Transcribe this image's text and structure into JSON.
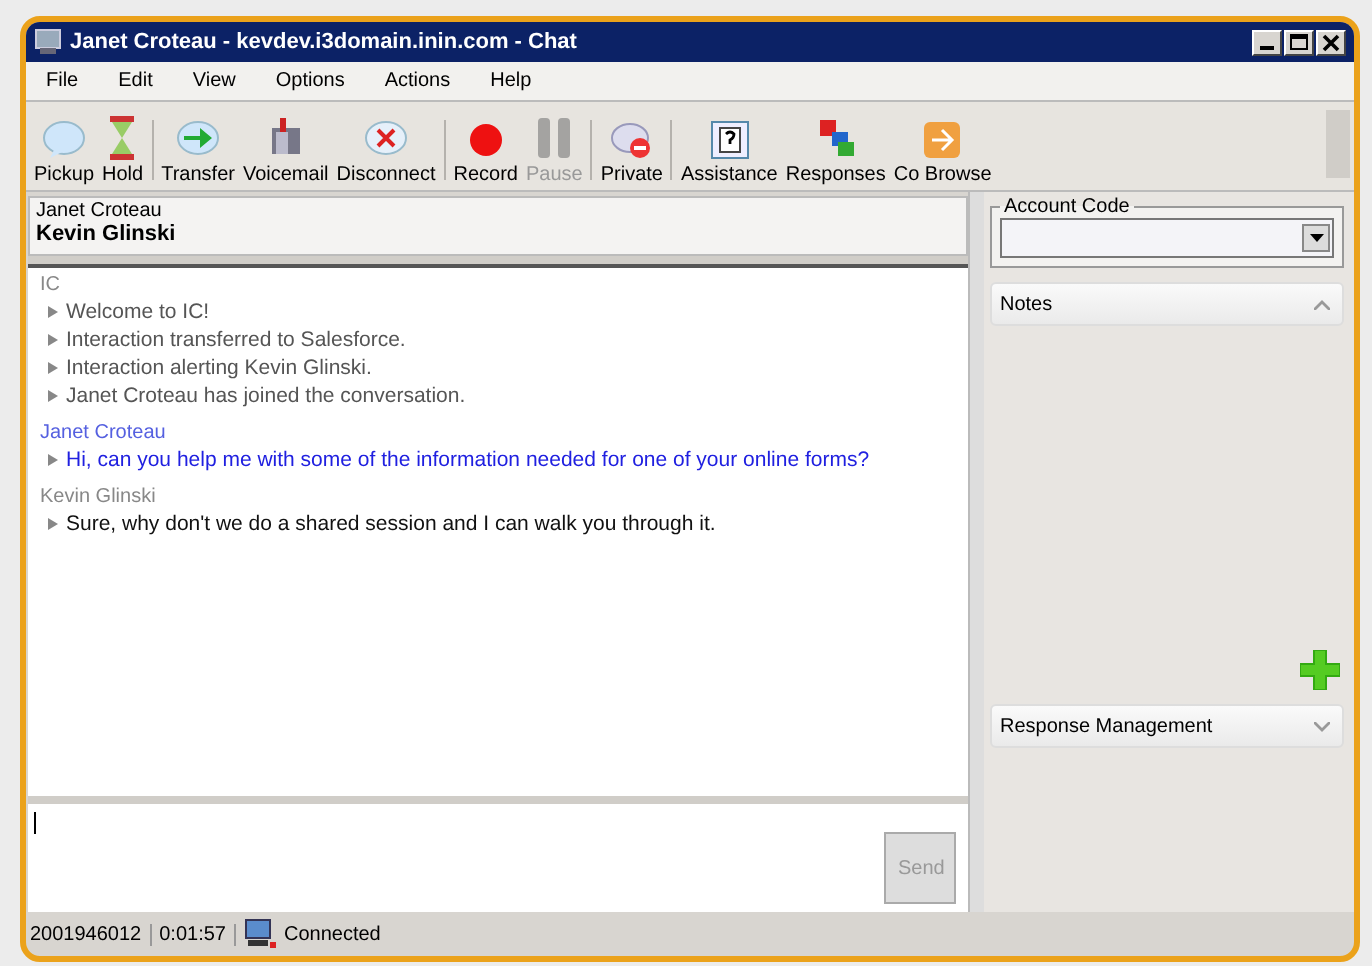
{
  "window": {
    "title": "Janet Croteau - kevdev.i3domain.inin.com - Chat"
  },
  "menu": [
    "File",
    "Edit",
    "View",
    "Options",
    "Actions",
    "Help"
  ],
  "toolbar": [
    {
      "label": "Pickup",
      "kind": "pickup",
      "disabled": false,
      "separator_before": false
    },
    {
      "label": "Hold",
      "kind": "hold",
      "disabled": false,
      "separator_before": false
    },
    {
      "label": "Transfer",
      "kind": "transfer",
      "disabled": false,
      "separator_before": true
    },
    {
      "label": "Voicemail",
      "kind": "voicemail",
      "disabled": false,
      "separator_before": false
    },
    {
      "label": "Disconnect",
      "kind": "disconnect",
      "disabled": false,
      "separator_before": false
    },
    {
      "label": "Record",
      "kind": "record",
      "disabled": false,
      "separator_before": true
    },
    {
      "label": "Pause",
      "kind": "pause",
      "disabled": true,
      "separator_before": false
    },
    {
      "label": "Private",
      "kind": "private",
      "disabled": false,
      "separator_before": true
    },
    {
      "label": "Assistance",
      "kind": "assistance",
      "disabled": false,
      "separator_before": true
    },
    {
      "label": "Responses",
      "kind": "responses",
      "disabled": false,
      "separator_before": false
    },
    {
      "label": "Co Browse",
      "kind": "cobrowse",
      "disabled": false,
      "separator_before": false
    }
  ],
  "participants": {
    "remote": "Janet Croteau",
    "local": "Kevin Glinski"
  },
  "transcript": [
    {
      "sender": "IC",
      "kind": "system",
      "messages": [
        "Welcome to IC!",
        "Interaction transferred to Salesforce.",
        "Interaction alerting Kevin Glinski.",
        "Janet Croteau has joined the conversation."
      ]
    },
    {
      "sender": "Janet Croteau",
      "kind": "customer",
      "messages": [
        "Hi, can you help me with some of the information needed for one of your online forms?"
      ]
    },
    {
      "sender": "Kevin Glinski",
      "kind": "agent",
      "messages": [
        "Sure, why don't we do a shared session and I can walk you through it."
      ]
    }
  ],
  "send_button": {
    "label": "Send",
    "disabled": true
  },
  "account_code": {
    "label": "Account Code"
  },
  "notes": {
    "label": "Notes",
    "expanded": true
  },
  "response_management": {
    "label": "Response Management",
    "expanded": false
  },
  "status_bar": {
    "interaction_id": "2001946012",
    "duration": "0:01:57",
    "status": "Connected"
  }
}
